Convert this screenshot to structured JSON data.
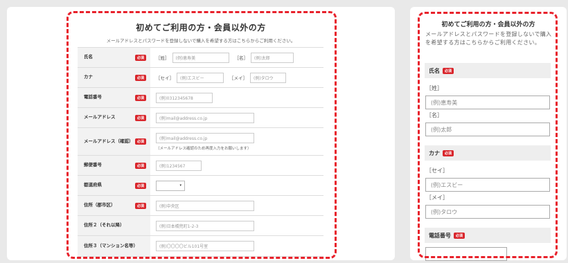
{
  "desktop": {
    "title": "初めてご利用の方・会員以外の方",
    "lead": "メールアドレスとパスワードを登録しないで購入を希望する方はこちらからご利用ください。",
    "required_label": "必須",
    "rows": {
      "name": {
        "label": "氏名",
        "sei_bracket": "［姓］",
        "sei_placeholder": "(例)恵寿美",
        "mei_bracket": "［名］",
        "mei_placeholder": "(例)太郎"
      },
      "kana": {
        "label": "カナ",
        "sei_bracket": "［セイ］",
        "sei_placeholder": "(例)エスビー",
        "mei_bracket": "［メイ］",
        "mei_placeholder": "(例)タロウ"
      },
      "tel": {
        "label": "電話番号",
        "placeholder": "(例)0312345678"
      },
      "email": {
        "label": "メールアドレス",
        "placeholder": "(例)mail@address.co.jp"
      },
      "email_confirm": {
        "label": "メールアドレス（確認）",
        "placeholder": "(例)mail@address.co.jp",
        "note": "（メールアドレス確認のため再度入力をお願いします）"
      },
      "zip": {
        "label": "郵便番号",
        "placeholder": "(例)1234567"
      },
      "pref": {
        "label": "都道府県",
        "selected": "▾"
      },
      "addr1": {
        "label": "住所（郡市区）",
        "placeholder": "(例)中央区"
      },
      "addr2": {
        "label": "住所２（それ以降）",
        "placeholder": "(例)日本橋兜町1-2-3"
      },
      "addr3": {
        "label": "住所３（マンション名等）",
        "placeholder": "(例)〇〇〇〇ビル101号室"
      }
    }
  },
  "mobile": {
    "title": "初めてご利用の方・会員以外の方",
    "lead": "メールアドレスとパスワードを登録しないで購入を希望する方はこちらからご利用ください。",
    "required_label": "必須",
    "name_label": "氏名",
    "sei_label": "［姓］",
    "sei_placeholder": "(例)恵寿美",
    "mei_label": "［名］",
    "mei_placeholder": "(例)太郎",
    "kana_label": "カナ",
    "kana_sei_label": "［セイ］",
    "kana_sei_placeholder": "(例)エスビー",
    "kana_mei_label": "［メイ］",
    "kana_mei_placeholder": "(例)タロウ",
    "tel_label": "電話番号"
  },
  "colors": {
    "accent": "#e8212b",
    "required_bg": "#d9262c"
  }
}
